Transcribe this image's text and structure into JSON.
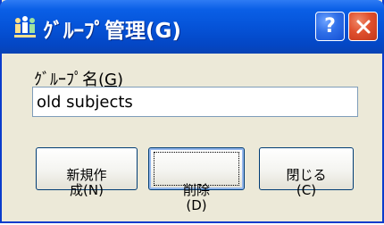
{
  "window": {
    "title": "ｸﾞﾙｰﾌﾟ管理(G)",
    "help_label": "?"
  },
  "form": {
    "group_name_label_prefix": "ｸﾞﾙｰﾌﾟ名(",
    "group_name_label_key": "G",
    "group_name_label_suffix": ")",
    "group_name_value": "old subjects"
  },
  "buttons": {
    "new_label": "新規作\n成(N)",
    "delete_label": "削除\n(D)",
    "close_label": "閉じる\n(C)"
  },
  "colors": {
    "titlebar": "#0553d8",
    "close_button": "#e0502e",
    "dialog_bg": "#ece9d8"
  },
  "icons": {
    "app": "group-people-icon",
    "help": "help-icon",
    "close": "close-icon"
  }
}
